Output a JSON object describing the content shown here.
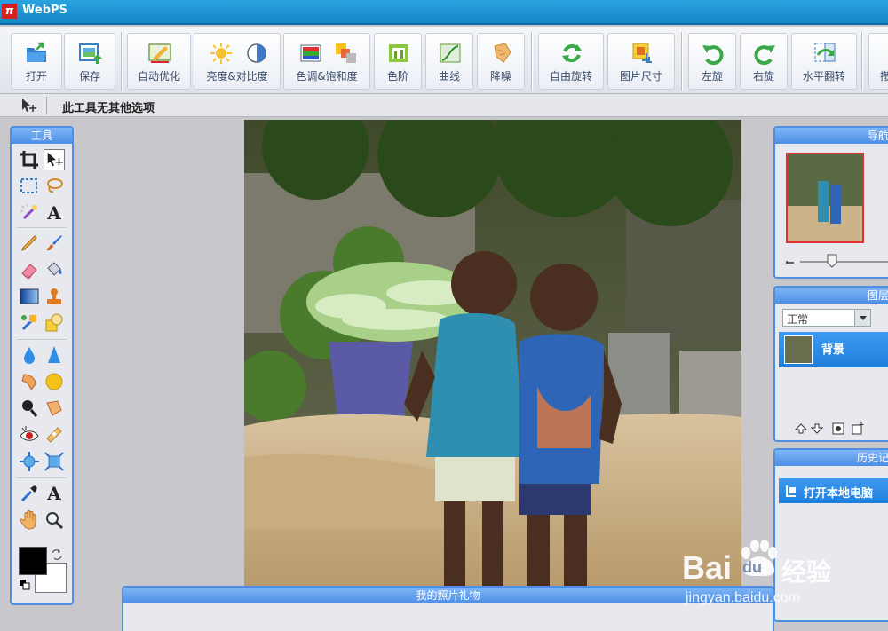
{
  "app": {
    "title": "WebPS",
    "logo_glyph": "π"
  },
  "toolbar": {
    "open": "打开",
    "save": "保存",
    "auto_enhance": "自动优化",
    "brightness_contrast": "亮度&对比度",
    "hue_saturation": "色调&饱和度",
    "levels": "色阶",
    "curves": "曲线",
    "denoise": "降噪",
    "free_rotate": "自由旋转",
    "image_size": "图片尺寸",
    "rotate_left": "左旋",
    "rotate_right": "右旋",
    "flip_horizontal": "水平翻转",
    "more": "撤"
  },
  "options": {
    "text": "此工具无其他选项"
  },
  "tools_panel": {
    "title": "工具",
    "text_tool_glyph": "A"
  },
  "navigator": {
    "title": "导航"
  },
  "layers": {
    "title": "图层",
    "blend_mode": "正常",
    "layer_name": "背景"
  },
  "history": {
    "title": "历史记",
    "entry": "打开本地电脑"
  },
  "bottom_panel": {
    "title": "我的照片礼物"
  },
  "watermark": {
    "brand": "Bai",
    "brand2": "du",
    "cn": "经验",
    "url": "jingyan.baidu.com"
  },
  "colors": {
    "accent": "#4f8fe0",
    "titlebar": "#1a8dcf",
    "foreground": "#000000",
    "background": "#ffffff"
  }
}
